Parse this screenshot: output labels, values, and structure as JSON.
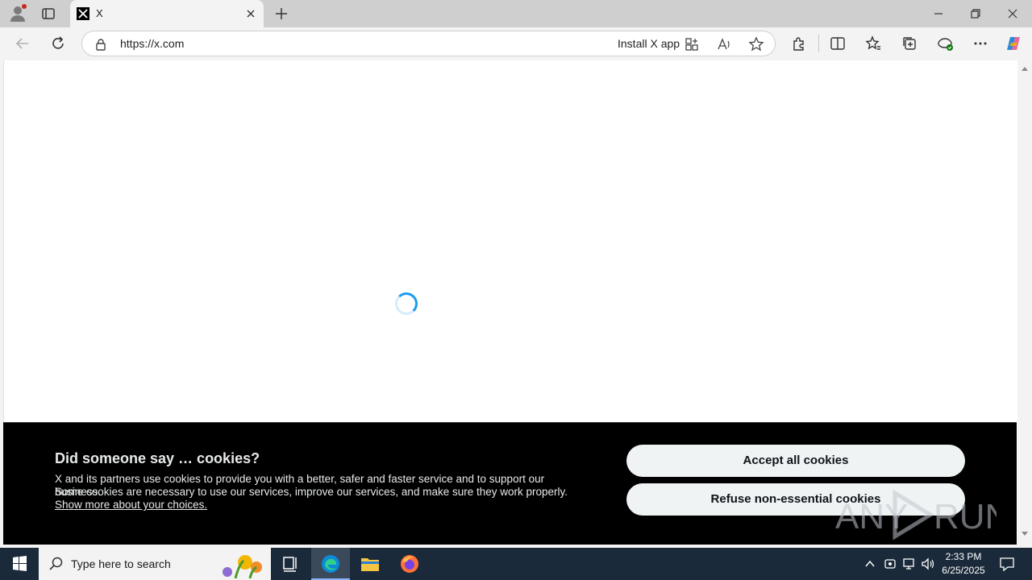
{
  "browser": {
    "tab_title": "X",
    "url": "https://x.com",
    "install_label": "Install X app"
  },
  "cookie_banner": {
    "heading": "Did someone say … cookies?",
    "line1": "X and its partners use cookies to provide you with a better, safer and faster service and to support our business.",
    "line2": "Some cookies are necessary to use our services, improve our services, and make sure they work properly.",
    "link": "Show more about your choices.",
    "accept_label": "Accept all cookies",
    "refuse_label": "Refuse non-essential cookies"
  },
  "watermark": {
    "text": "ANY RUN"
  },
  "taskbar": {
    "search_placeholder": "Type here to search",
    "time": "2:33 PM",
    "date": "6/25/2025"
  },
  "colors": {
    "accent": "#1d9bf0",
    "banner_bg": "#000000",
    "button_bg": "#eff3f4",
    "taskbar_bg": "#1b2a3a"
  }
}
